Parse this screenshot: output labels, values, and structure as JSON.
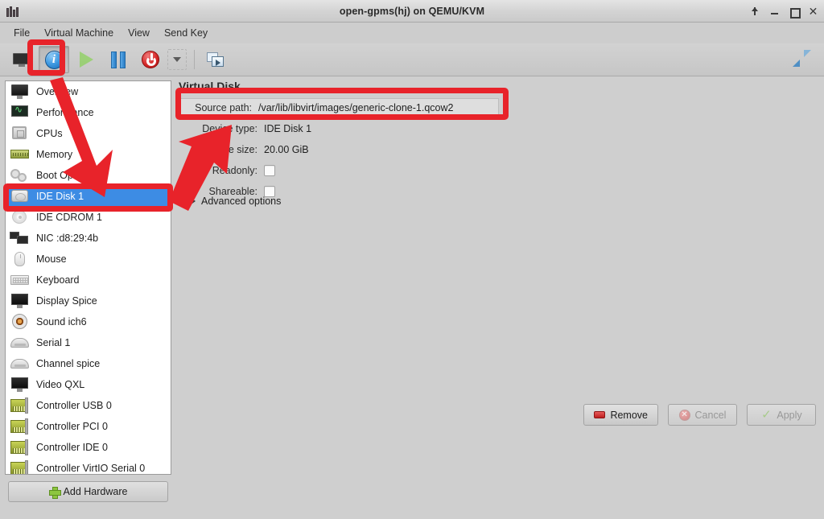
{
  "window": {
    "title": "open-gpms(hj) on QEMU/KVM",
    "logo_icon": "virt-manager-logo-icon",
    "controls": [
      {
        "name": "pin-window-button",
        "icon": "pin-icon",
        "label": ""
      },
      {
        "name": "minimize-button",
        "icon": "minimize-icon",
        "label": ""
      },
      {
        "name": "maximize-button",
        "icon": "maximize-icon",
        "label": ""
      },
      {
        "name": "close-button",
        "icon": "close-icon",
        "label": "✕"
      }
    ]
  },
  "menubar": {
    "items": [
      {
        "label": "File"
      },
      {
        "label": "Virtual Machine"
      },
      {
        "label": "View"
      },
      {
        "label": "Send Key"
      }
    ]
  },
  "toolbar": {
    "buttons": [
      {
        "name": "show-console-button",
        "icon": "monitor-icon",
        "pressed": false
      },
      {
        "name": "show-details-button",
        "icon": "info-icon",
        "pressed": true,
        "glyph": "i"
      },
      {
        "name": "run-vm-button",
        "icon": "play-icon",
        "pressed": false
      },
      {
        "name": "pause-vm-button",
        "icon": "pause-icon",
        "pressed": false
      },
      {
        "name": "shutdown-vm-button",
        "icon": "power-icon",
        "pressed": false
      },
      {
        "name": "shutdown-options-dropdown",
        "icon": "chevron-down-icon",
        "pressed": false
      },
      {
        "name": "snapshots-button",
        "icon": "snapshot-icon",
        "pressed": false
      }
    ],
    "right_button": {
      "name": "fullscreen-button",
      "icon": "fullscreen-icon"
    }
  },
  "sidebar": {
    "items": [
      {
        "label": "Overview",
        "icon": "monitor-icon",
        "icon_class": "i-display",
        "selected": false
      },
      {
        "label": "Performance",
        "icon": "performance-icon",
        "icon_class": "i-perf",
        "selected": false
      },
      {
        "label": "CPUs",
        "icon": "cpu-chip-icon",
        "icon_class": "i-cpu",
        "selected": false
      },
      {
        "label": "Memory",
        "icon": "memory-icon",
        "icon_class": "i-mem",
        "selected": false
      },
      {
        "label": "Boot Options",
        "icon": "gears-icon",
        "icon_class": "i-boot",
        "selected": false
      },
      {
        "label": "IDE Disk 1",
        "icon": "hard-disk-icon",
        "icon_class": "i-disk",
        "selected": true
      },
      {
        "label": "IDE CDROM 1",
        "icon": "cdrom-icon",
        "icon_class": "i-cdrom",
        "selected": false
      },
      {
        "label": "NIC :d8:29:4b",
        "icon": "network-card-icon",
        "icon_class": "i-nic",
        "selected": false
      },
      {
        "label": "Mouse",
        "icon": "mouse-icon",
        "icon_class": "i-mouse",
        "selected": false
      },
      {
        "label": "Keyboard",
        "icon": "keyboard-icon",
        "icon_class": "i-kbd",
        "selected": false
      },
      {
        "label": "Display Spice",
        "icon": "monitor-icon",
        "icon_class": "i-video",
        "selected": false
      },
      {
        "label": "Sound ich6",
        "icon": "sound-icon",
        "icon_class": "i-sound",
        "selected": false
      },
      {
        "label": "Serial 1",
        "icon": "serial-port-icon",
        "icon_class": "i-serial",
        "selected": false
      },
      {
        "label": "Channel spice",
        "icon": "serial-port-icon",
        "icon_class": "i-serial",
        "selected": false
      },
      {
        "label": "Video QXL",
        "icon": "monitor-icon",
        "icon_class": "i-video",
        "selected": false
      },
      {
        "label": "Controller USB 0",
        "icon": "controller-card-icon",
        "icon_class": "i-ctrl",
        "selected": false
      },
      {
        "label": "Controller PCI 0",
        "icon": "controller-card-icon",
        "icon_class": "i-ctrl",
        "selected": false
      },
      {
        "label": "Controller IDE 0",
        "icon": "controller-card-icon",
        "icon_class": "i-ctrl",
        "selected": false
      },
      {
        "label": "Controller VirtIO Serial 0",
        "icon": "controller-card-icon",
        "icon_class": "i-ctrl",
        "selected": false
      }
    ],
    "add_hardware": {
      "label": "Add Hardware",
      "icon": "plus-icon"
    }
  },
  "panel": {
    "title": "Virtual Disk",
    "fields": [
      {
        "label": "Source path:",
        "value": "/var/lib/libvirt/images/generic-clone-1.qcow2",
        "type": "readonly-text",
        "boxed": true
      },
      {
        "label": "Device type:",
        "value": "IDE Disk 1",
        "type": "readonly-text",
        "boxed": false
      },
      {
        "label": "Storage size:",
        "value": "20.00 GiB",
        "type": "readonly-text",
        "boxed": false
      },
      {
        "label": "Readonly:",
        "value": "",
        "type": "checkbox",
        "checked": false
      },
      {
        "label": "Shareable:",
        "value": "",
        "type": "checkbox",
        "checked": false
      }
    ],
    "advanced": {
      "label": "Advanced options",
      "icon": "chevron-right-icon",
      "expanded": false
    }
  },
  "footer": {
    "buttons": [
      {
        "name": "remove-button",
        "label": "Remove",
        "icon": "remove-icon",
        "disabled": false
      },
      {
        "name": "cancel-button",
        "label": "Cancel",
        "icon": "cancel-icon",
        "disabled": true
      },
      {
        "name": "apply-button",
        "label": "Apply",
        "icon": "check-icon",
        "disabled": true
      }
    ]
  },
  "annotations": {
    "color": "#e8232a",
    "boxes": [
      {
        "name": "annotation-box-info-button",
        "target": "show-details-button"
      },
      {
        "name": "annotation-box-source-path",
        "target": "source-path-field"
      },
      {
        "name": "annotation-box-ide-disk",
        "target": "sidebar-item-ide-disk-1"
      }
    ],
    "arrows": [
      {
        "name": "annotation-arrow-to-ide-disk",
        "from": "info-button",
        "to": "ide-disk-row"
      },
      {
        "name": "annotation-arrow-to-source-path",
        "from": "ide-disk-row",
        "to": "source-path-field"
      }
    ]
  }
}
